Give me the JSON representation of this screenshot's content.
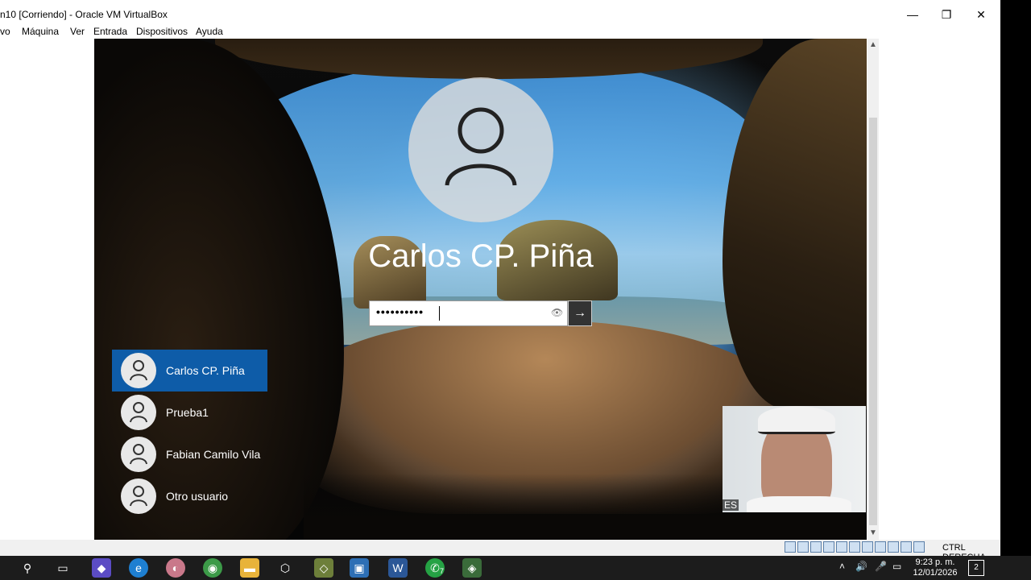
{
  "window": {
    "title": "n10 [Corriendo] - Oracle VM VirtualBox",
    "minimize": "—",
    "restore": "❐",
    "close": "✕"
  },
  "menu": [
    "vo",
    "Máquina",
    "Ver",
    "Entrada",
    "Dispositivos",
    "Ayuda"
  ],
  "login": {
    "user_name": "Carlos CP. Piña",
    "password_mask": "••••••••••",
    "reveal_icon": "eye-icon",
    "submit_icon": "arrow-right-icon",
    "submit_glyph": "→"
  },
  "users": [
    {
      "label": "Carlos CP. Piña",
      "active": true
    },
    {
      "label": "Prueba1",
      "active": false
    },
    {
      "label": "Fabian Camilo Vila",
      "active": false
    },
    {
      "label": "Otro usuario",
      "active": false
    }
  ],
  "webcam": {
    "overlay_text": "ES"
  },
  "statusbar": {
    "host_key": "CTRL DERECHA"
  },
  "taskbar": {
    "clock_time": "9:23 p. m.",
    "clock_date": "12/01/2026",
    "notification_count": "2",
    "whatsapp_badge": "7"
  },
  "colors": {
    "accent": "#0e5ca8",
    "taskbar": "#1c1c1c"
  }
}
